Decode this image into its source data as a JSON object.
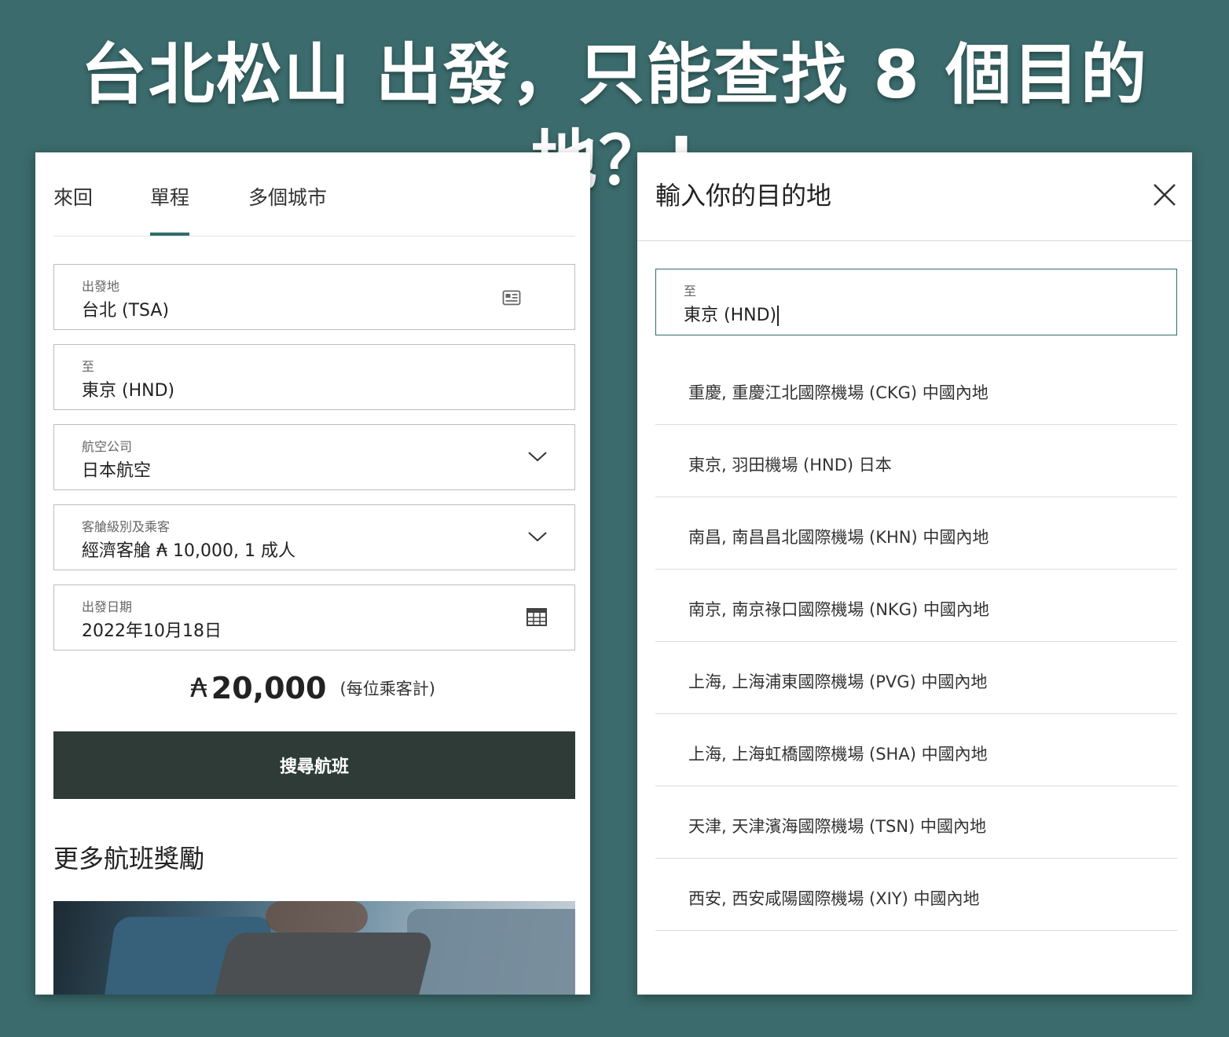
{
  "headline": "台北松山 出發，只能查找 8 個目的地？!",
  "left": {
    "tabs": [
      "來回",
      "單程",
      "多個城市"
    ],
    "active_tab": "單程",
    "fields": {
      "origin": {
        "label": "出發地",
        "value": "台北 (TSA)",
        "icon": "contact-card-icon"
      },
      "destination": {
        "label": "至",
        "value": "東京 (HND)"
      },
      "airline": {
        "label": "航空公司",
        "value": "日本航空",
        "icon": "chevron-down-icon"
      },
      "cabin": {
        "label": "客艙級別及乘客",
        "value": "經濟客艙 ₳ 10,000, 1 成人",
        "icon": "chevron-down-icon"
      },
      "date": {
        "label": "出發日期",
        "value": "2022年10月18日",
        "icon": "calendar-icon"
      }
    },
    "price": {
      "currency": "₳",
      "amount": "20,000",
      "note": "(每位乘客計)"
    },
    "search_button": "搜尋航班",
    "more_title": "更多航班獎勵"
  },
  "right": {
    "title": "輸入你的目的地",
    "close_icon": "close-icon",
    "to_field": {
      "label": "至",
      "value": "東京 (HND)"
    },
    "results": [
      "重慶, 重慶江北國際機場 (CKG) 中國內地",
      "東京, 羽田機場 (HND) 日本",
      "南昌, 南昌昌北國際機場 (KHN) 中國內地",
      "南京, 南京祿口國際機場 (NKG) 中國內地",
      "上海, 上海浦東國際機場 (PVG) 中國內地",
      "上海, 上海虹橋國際機場 (SHA) 中國內地",
      "天津, 天津濱海國際機場 (TSN) 中國內地",
      "西安, 西安咸陽國際機場 (XIY) 中國內地"
    ]
  },
  "colors": {
    "background": "#3b6b6c",
    "accent": "#2f6d68",
    "button": "#2e3b36"
  }
}
